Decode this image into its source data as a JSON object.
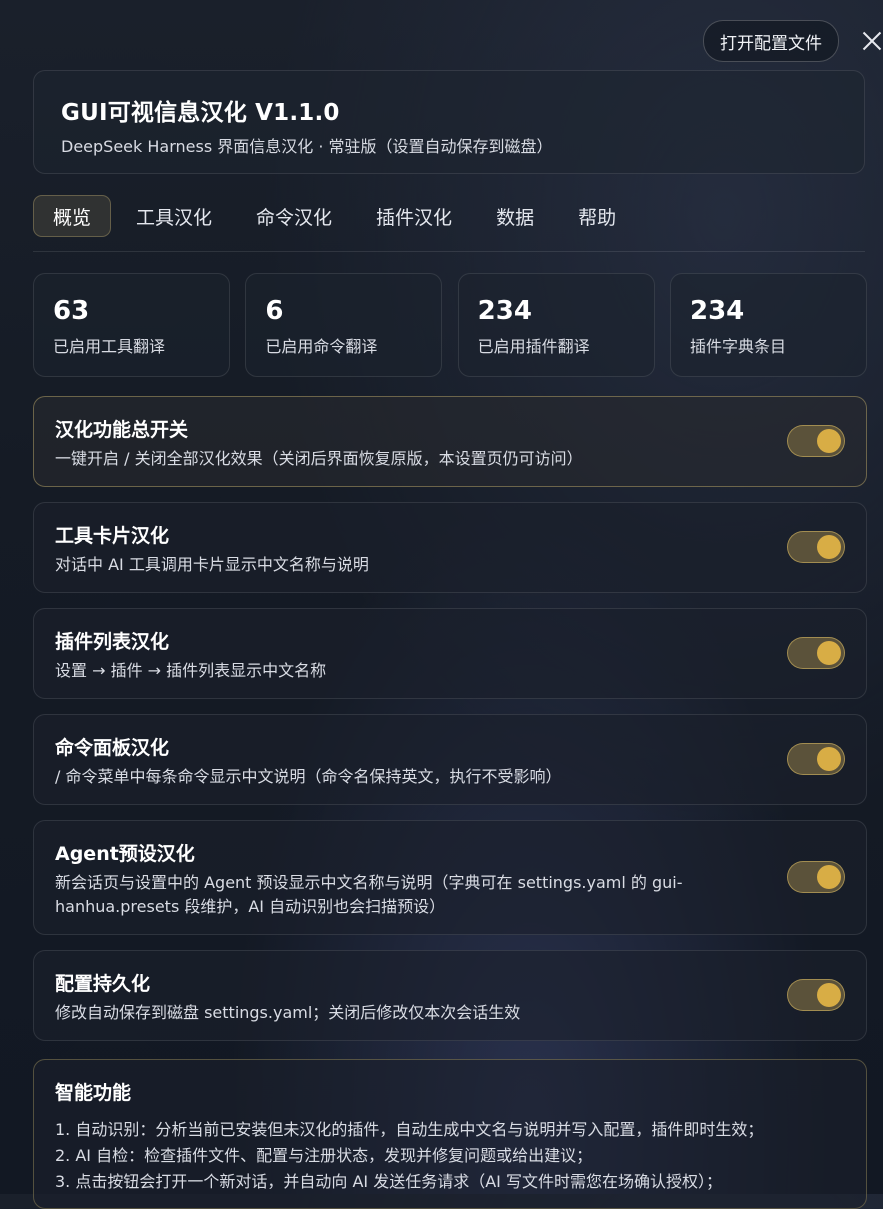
{
  "topbar": {
    "open_config_label": "打开配置文件"
  },
  "header": {
    "title": "GUI可视信息汉化 V1.1.0",
    "subtitle": "DeepSeek Harness 界面信息汉化 · 常驻版（设置自动保存到磁盘）"
  },
  "tabs": [
    {
      "label": "概览",
      "active": true
    },
    {
      "label": "工具汉化",
      "active": false
    },
    {
      "label": "命令汉化",
      "active": false
    },
    {
      "label": "插件汉化",
      "active": false
    },
    {
      "label": "数据",
      "active": false
    },
    {
      "label": "帮助",
      "active": false
    }
  ],
  "stats": [
    {
      "value": "63",
      "label": "已启用工具翻译"
    },
    {
      "value": "6",
      "label": "已启用命令翻译"
    },
    {
      "value": "234",
      "label": "已启用插件翻译"
    },
    {
      "value": "234",
      "label": "插件字典条目"
    }
  ],
  "settings": [
    {
      "title": "汉化功能总开关",
      "desc": "一键开启 / 关闭全部汉化效果（关闭后界面恢复原版，本设置页仍可访问）",
      "enabled": true
    },
    {
      "title": "工具卡片汉化",
      "desc": "对话中 AI 工具调用卡片显示中文名称与说明",
      "enabled": true
    },
    {
      "title": "插件列表汉化",
      "desc": "设置 → 插件 → 插件列表显示中文名称",
      "enabled": true
    },
    {
      "title": "命令面板汉化",
      "desc": "/ 命令菜单中每条命令显示中文说明（命令名保持英文，执行不受影响）",
      "enabled": true
    },
    {
      "title": "Agent预设汉化",
      "desc": "新会话页与设置中的 Agent 预设显示中文名称与说明（字典可在 settings.yaml 的 gui-hanhua.presets 段维护，AI 自动识别也会扫描预设）",
      "enabled": true
    },
    {
      "title": "配置持久化",
      "desc": "修改自动保存到磁盘 settings.yaml；关闭后修改仅本次会话生效",
      "enabled": true
    }
  ],
  "smart": {
    "title": "智能功能",
    "items": [
      "1. 自动识别：分析当前已安装但未汉化的插件，自动生成中文名与说明并写入配置，插件即时生效；",
      "2. AI 自检：检查插件文件、配置与注册状态，发现并修复问题或给出建议；",
      "3. 点击按钮会打开一个新对话，并自动向 AI 发送任务请求（AI 写文件时需您在场确认授权）；"
    ]
  },
  "colors": {
    "accent": "#d8ad45",
    "toggle_track": "#5b523a",
    "background": "#151b25"
  }
}
